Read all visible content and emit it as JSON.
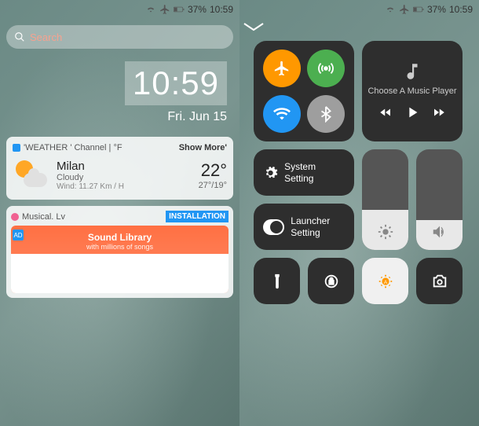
{
  "statusbar": {
    "battery": "37%",
    "time": "10:59"
  },
  "search": {
    "placeholder": "Search"
  },
  "clock": {
    "time": "10:59",
    "date": "Fri. Jun 15"
  },
  "weather": {
    "channel_label": "'WEATHER ' Channel | °F",
    "show_more": "Show More'",
    "city": "Milan",
    "condition": "Cloudy",
    "wind": "Wind: 11.27 Km / H",
    "temp": "22°",
    "range": "27°/19°"
  },
  "music_card": {
    "title": "Musical. Lv",
    "badge": "INSTALLATION",
    "ad_label": "AD",
    "lib_title": "Sound Library",
    "lib_sub": "with millions of songs"
  },
  "cc": {
    "music_prompt": "Choose A Music Player",
    "system_label": "System Setting",
    "launcher_label": "Launcher Setting",
    "colors": {
      "airplane": "#ff9800",
      "cellular": "#4caf50",
      "wifi": "#2196f3",
      "bluetooth": "#9e9e9e"
    }
  }
}
